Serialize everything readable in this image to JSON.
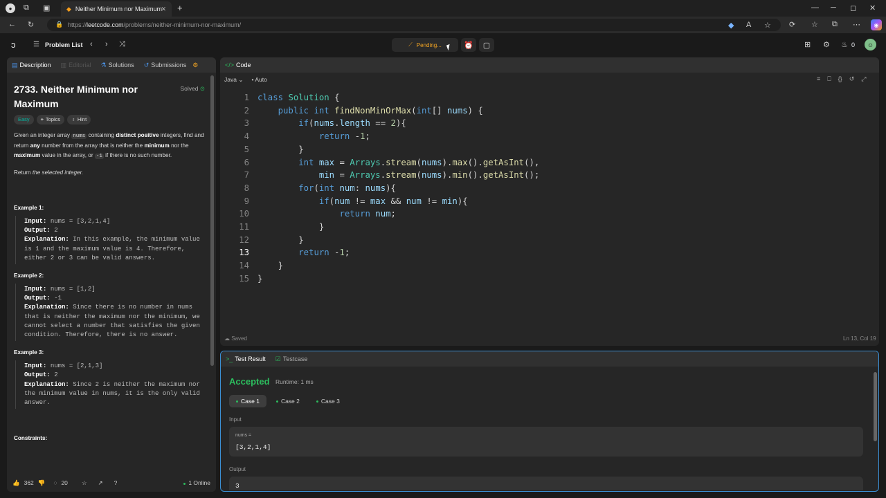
{
  "browser": {
    "tab_title": "Neither Minimum nor Maximum",
    "url_domain": "leetcode.com",
    "url_path": "/problems/neither-minimum-nor-maximum/"
  },
  "header": {
    "problem_list": "Problem List",
    "pending": "Pending...",
    "streak": "0"
  },
  "left": {
    "tabs": [
      "Description",
      "Editorial",
      "Solutions",
      "Submissions"
    ],
    "title": "2733. Neither Minimum nor Maximum",
    "solved": "Solved",
    "tags": [
      "Easy",
      "Topics",
      "Hint"
    ],
    "p1_a": "Given an integer array",
    "p1_code": "nums",
    "p1_b": "containing",
    "p1_bold1": "distinct positive",
    "p1_c": "integers, find and return",
    "p1_bold2": "any",
    "p1_d": "number from the array that is neither the",
    "p1_bold3": "minimum",
    "p1_e": "nor the",
    "p1_bold4": "maximum",
    "p1_f": "value in the array, or",
    "p1_code2": "-1",
    "p1_g": "if there is no such number.",
    "p2_a": "Return",
    "p2_i": "the selected integer.",
    "examples": [
      {
        "h": "Example 1:",
        "input": "nums = [3,2,1,4]",
        "output": "2",
        "exp": "In this example, the minimum value is 1 and the maximum value is 4. Therefore, either 2 or 3 can be valid answers."
      },
      {
        "h": "Example 2:",
        "input": "nums = [1,2]",
        "output": "-1",
        "exp": "Since there is no number in nums that is neither the maximum nor the minimum, we cannot select a number that satisfies the given condition. Therefore, there is no answer."
      },
      {
        "h": "Example 3:",
        "input": "nums = [2,1,3]",
        "output": "2",
        "exp": "Since 2 is neither the maximum nor the minimum value in nums, it is the only valid answer."
      }
    ],
    "labels": {
      "input": "Input:",
      "output": "Output:",
      "explanation": "Explanation:"
    },
    "constraints": "Constraints:",
    "likes": "362",
    "comments": "20",
    "online": "1 Online"
  },
  "code": {
    "tab": "Code",
    "lang": "Java",
    "auto": "Auto",
    "saved": "Saved",
    "cursor": "Ln 13, Col 19"
  },
  "result": {
    "tabs": [
      "Test Result",
      "Testcase"
    ],
    "status": "Accepted",
    "runtime": "Runtime: 1 ms",
    "cases": [
      "Case 1",
      "Case 2",
      "Case 3"
    ],
    "input_label": "Input",
    "var_label": "nums =",
    "var_value": "[3,2,1,4]",
    "output_label": "Output",
    "output_value": "3"
  }
}
